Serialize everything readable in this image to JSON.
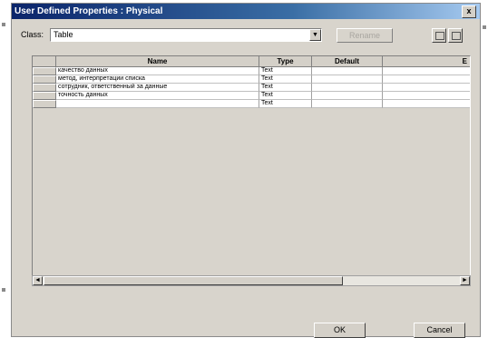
{
  "window": {
    "title": "User Defined Properties : Physical",
    "close_glyph": "x"
  },
  "class_field": {
    "label": "Class:",
    "value": "Table",
    "dropdown_glyph": "▼"
  },
  "toolbar": {
    "rename_label": "Rename"
  },
  "grid": {
    "columns": [
      "Name",
      "Type",
      "Default",
      "E"
    ],
    "rows": [
      {
        "name": "качество данных",
        "type": "Text",
        "default": ""
      },
      {
        "name": "метод, интерпретации списка",
        "type": "Text",
        "default": ""
      },
      {
        "name": "сотрудник, ответственный за данные",
        "type": "Text",
        "default": ""
      },
      {
        "name": "точность данных",
        "type": "Text",
        "default": ""
      },
      {
        "name": "",
        "type": "Text",
        "default": ""
      }
    ]
  },
  "scrollbar": {
    "left_glyph": "◄",
    "right_glyph": "►"
  },
  "buttons": {
    "ok": "OK",
    "cancel": "Cancel"
  }
}
